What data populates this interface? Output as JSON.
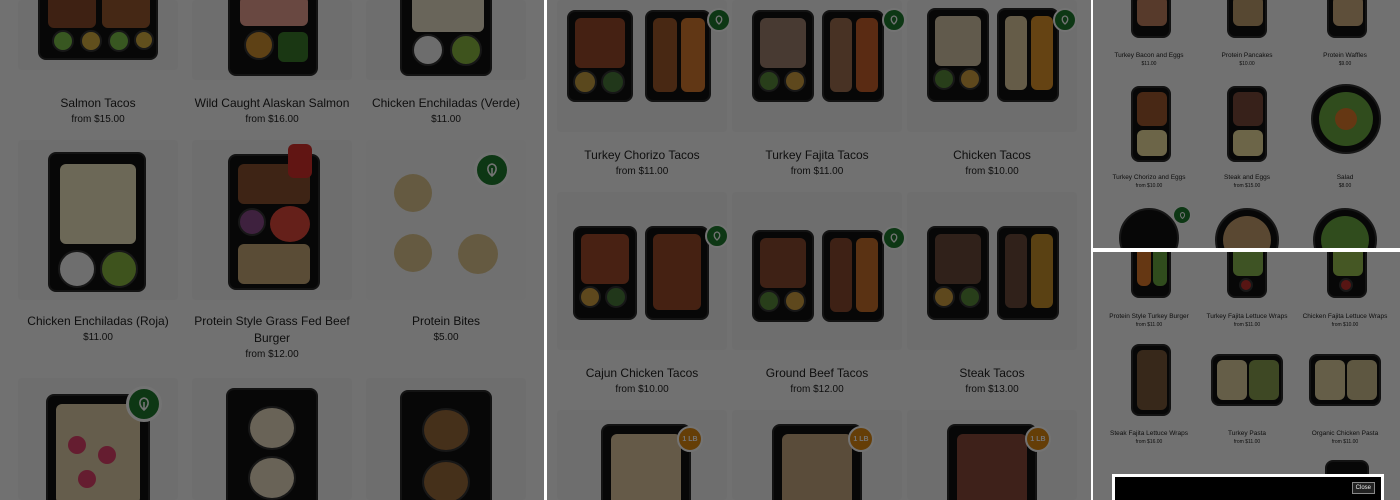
{
  "panel_left": {
    "items": [
      {
        "name": "Salmon Tacos",
        "price": "from $15.00"
      },
      {
        "name": "Wild Caught Alaskan Salmon",
        "price": "from $16.00"
      },
      {
        "name": "Chicken Enchiladas (Verde)",
        "price": "$11.00"
      },
      {
        "name": "Chicken Enchiladas (Roja)",
        "price": "$11.00"
      },
      {
        "name": "Protein Style Grass Fed Beef",
        "name2": "Burger",
        "price": "from $12.00"
      },
      {
        "name": "Protein Bites",
        "price": "$5.00"
      }
    ]
  },
  "panel_middle": {
    "items": [
      {
        "name": "Turkey Chorizo Tacos",
        "price": "from $11.00"
      },
      {
        "name": "Turkey Fajita Tacos",
        "price": "from $11.00"
      },
      {
        "name": "Chicken Tacos",
        "price": "from $10.00"
      },
      {
        "name": "Cajun Chicken Tacos",
        "price": "from $10.00"
      },
      {
        "name": "Ground Beef Tacos",
        "price": "from $12.00"
      },
      {
        "name": "Steak Tacos",
        "price": "from $13.00"
      }
    ],
    "badge_label": "1 LB"
  },
  "panel_right_top": {
    "items": [
      {
        "name": "Turkey Bacon and Eggs",
        "price": "$11.00"
      },
      {
        "name": "Protein Pancakes",
        "price": "$10.00"
      },
      {
        "name": "Protein Waffles",
        "price": "$9.00"
      },
      {
        "name": "Turkey Chorizo and Eggs",
        "price": "from $10.00"
      },
      {
        "name": "Steak and Eggs",
        "price": "from $15.00"
      },
      {
        "name": "Salad",
        "price": "$8.00"
      }
    ]
  },
  "panel_right_bottom": {
    "items": [
      {
        "name": "Protein Style Turkey Burger",
        "price": "from $11.00"
      },
      {
        "name": "Turkey Fajita Lettuce Wraps",
        "price": "from $11.00"
      },
      {
        "name": "Chicken Fajita Lettuce Wraps",
        "price": "from $10.00"
      },
      {
        "name": "Steak Fajita Lettuce Wraps",
        "price": "from $16.00"
      },
      {
        "name": "Turkey Pasta",
        "price": "from $11.00"
      },
      {
        "name": "Organic Chicken Pasta",
        "price": "from $11.00"
      }
    ],
    "close_label": "Close"
  },
  "colors": {
    "vegan_badge": "#1e7a2e",
    "pound_badge": "#e08a10",
    "overlay": "rgba(0,0,0,0.55)"
  },
  "icons": {
    "vegan": "leaf-icon",
    "pound": "one-pound-badge"
  }
}
